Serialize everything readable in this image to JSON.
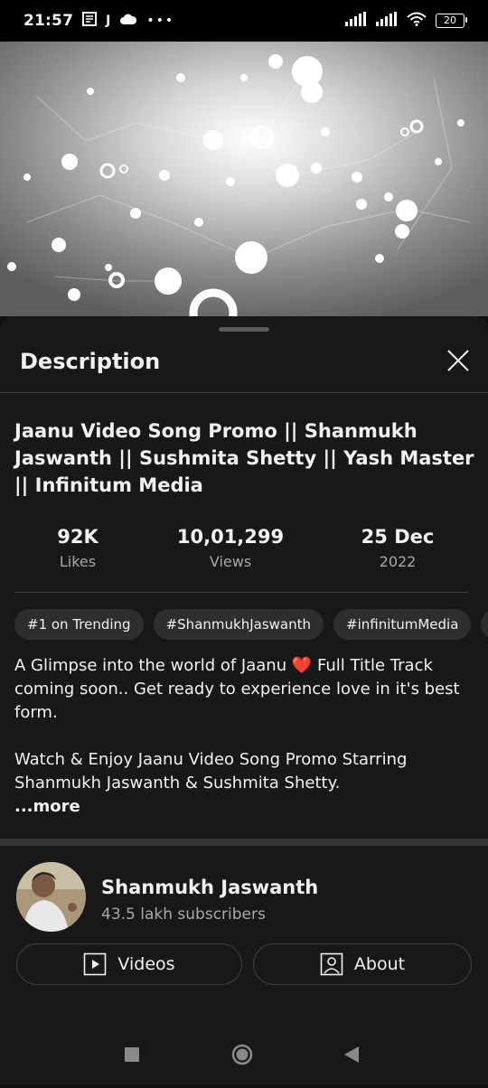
{
  "status_bar": {
    "time": "21:57",
    "notification_icons": [
      "news-icon",
      "j-icon",
      "cloud-icon",
      "more-dots-icon"
    ],
    "battery": "20"
  },
  "sheet": {
    "title": "Description",
    "video_title": "Jaanu Video Song Promo || Shanmukh Jaswanth || Sushmita Shetty || Yash Master || Infinitum Media",
    "stats": [
      {
        "value": "92K",
        "label": "Likes"
      },
      {
        "value": "10,01,299",
        "label": "Views"
      },
      {
        "value": "25 Dec",
        "label": "2022"
      }
    ],
    "tags": [
      "#1 on Trending",
      "#ShanmukhJaswanth",
      "#infinitumMedia",
      "#"
    ],
    "description": {
      "p1_before": "A Glimpse into the world of Jaanu ",
      "heart": "❤️",
      "p1_after": " Full Title Track coming soon.. Get ready to experience love in it's best form.",
      "p2": "Watch & Enjoy Jaanu Video Song Promo Starring Shanmukh Jaswanth & Sushmita Shetty.",
      "more": "...more"
    }
  },
  "channel": {
    "name": "Shanmukh Jaswanth",
    "subscribers": "43.5 lakh subscribers",
    "videos_label": "Videos",
    "about_label": "About"
  },
  "colors": {
    "background": "#0f0f0f",
    "sheet": "#181818",
    "chip": "#2e2e2e",
    "secondary_text": "#a8a8a8",
    "heart": "#e0283c"
  }
}
